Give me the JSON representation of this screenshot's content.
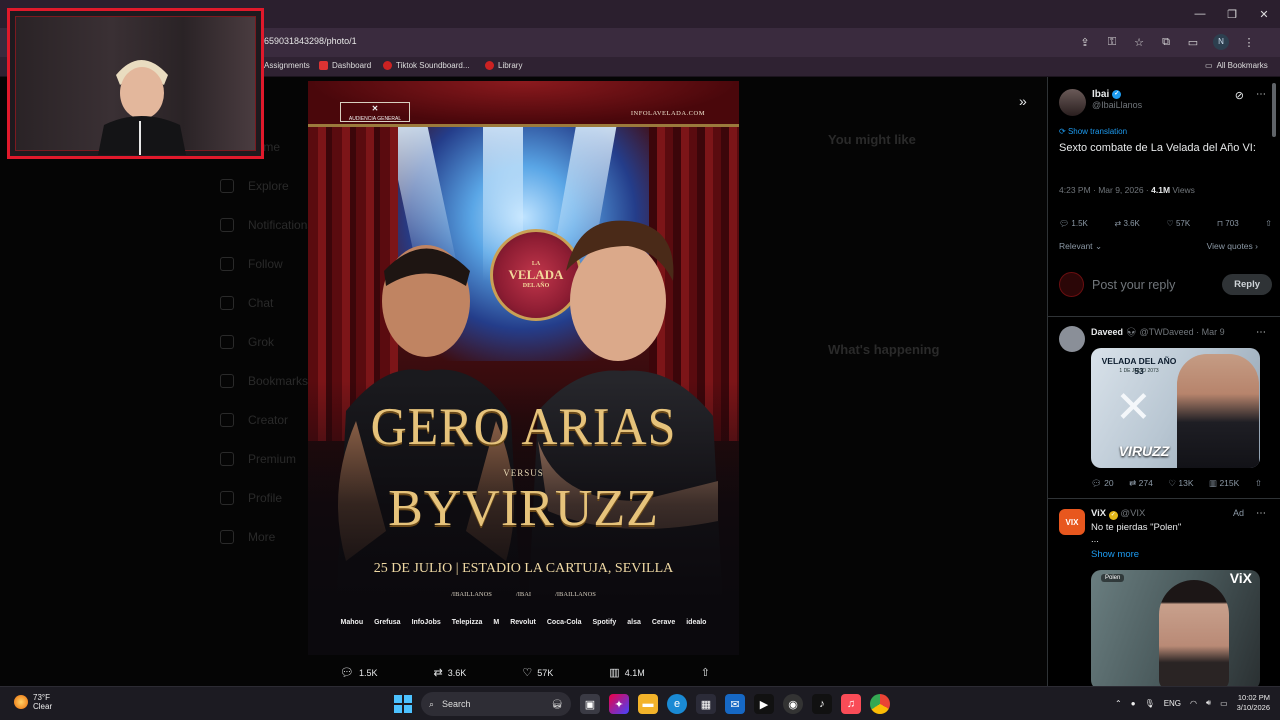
{
  "browser": {
    "url": "659031843298/photo/1",
    "bookmarks": [
      {
        "label": "Assignments",
        "color": "#888"
      },
      {
        "label": "Dashboard",
        "color": "#d33"
      },
      {
        "label": "Tiktok Soundboard...",
        "color": "#c22"
      },
      {
        "label": "Library",
        "color": "#c22"
      }
    ],
    "all_bookmarks": "All Bookmarks",
    "profile_initial": "N"
  },
  "background_nav": [
    "Home",
    "Explore",
    "Notifications",
    "Follow",
    "Chat",
    "Grok",
    "Bookmarks",
    "Creator",
    "Premium",
    "Profile",
    "More"
  ],
  "background_right": {
    "you_might_like": "You might like",
    "whats_happening": "What's happening"
  },
  "poster": {
    "badge": "AUDIENCIA GENERAL",
    "site": "INFOLAVELADA.COM",
    "emblem_top": "LA",
    "emblem_main": "VELADA",
    "emblem_sub": "DEL AÑO",
    "fighter1": "GERO ARIAS",
    "versus": "VERSUS",
    "fighter2": "BYVIRUZZ",
    "date_venue": "25 DE JULIO | ESTADIO LA CARTUJA, SEVILLA",
    "handles": [
      "/IBAILLANOS",
      "/IBAI",
      "/IBAILLANOS"
    ],
    "sponsors": [
      "Mahou",
      "Grefusa",
      "InfoJobs",
      "Telepizza",
      "M",
      "Revolut",
      "Coca-Cola",
      "Spotify",
      "alsa",
      "Cerave",
      "idealo"
    ]
  },
  "photo_actions": {
    "replies": "1.5K",
    "reposts": "3.6K",
    "likes": "57K",
    "views": "4.1M"
  },
  "tweet": {
    "name": "Ibai",
    "handle": "@IbaiLlanos",
    "show_translation": "Show translation",
    "text": "Sexto combate de La Velada del Año VI:",
    "time": "4:23 PM · Mar 9, 2026 ·",
    "views_count": "4.1M",
    "views_label": " Views",
    "stats": {
      "replies": "1.5K",
      "reposts": "3.6K",
      "likes": "57K",
      "bookmarks": "703"
    },
    "sort": "Relevant",
    "view_quotes": "View quotes",
    "reply_placeholder": "Post your reply",
    "reply_button": "Reply"
  },
  "reply1": {
    "name": "Daveed",
    "meta": "@TWDaveed · Mar 9",
    "media_title": "VELADA DEL AÑO 53",
    "media_sub": "1 DE JULIO 2073",
    "media_name": "VIRUZZ",
    "stats": {
      "replies": "20",
      "reposts": "274",
      "likes": "13K",
      "views": "215K"
    }
  },
  "ad": {
    "logo": "VIX",
    "name": "ViX",
    "handle": "@VIX",
    "tag": "Ad",
    "text": "No te pierdas \"Polen\"",
    "ellipsis": "...",
    "show_more": "Show more",
    "media_label": "Polen",
    "media_brand": "ViX"
  },
  "taskbar": {
    "temp": "73°F",
    "condition": "Clear",
    "search": "Search",
    "lang": "ENG",
    "time": "10:02 PM",
    "date": "3/10/2026"
  },
  "colors": {
    "accent": "#1d9bf0",
    "webcam_border": "#e0192b",
    "gold": "#e6c37b"
  }
}
